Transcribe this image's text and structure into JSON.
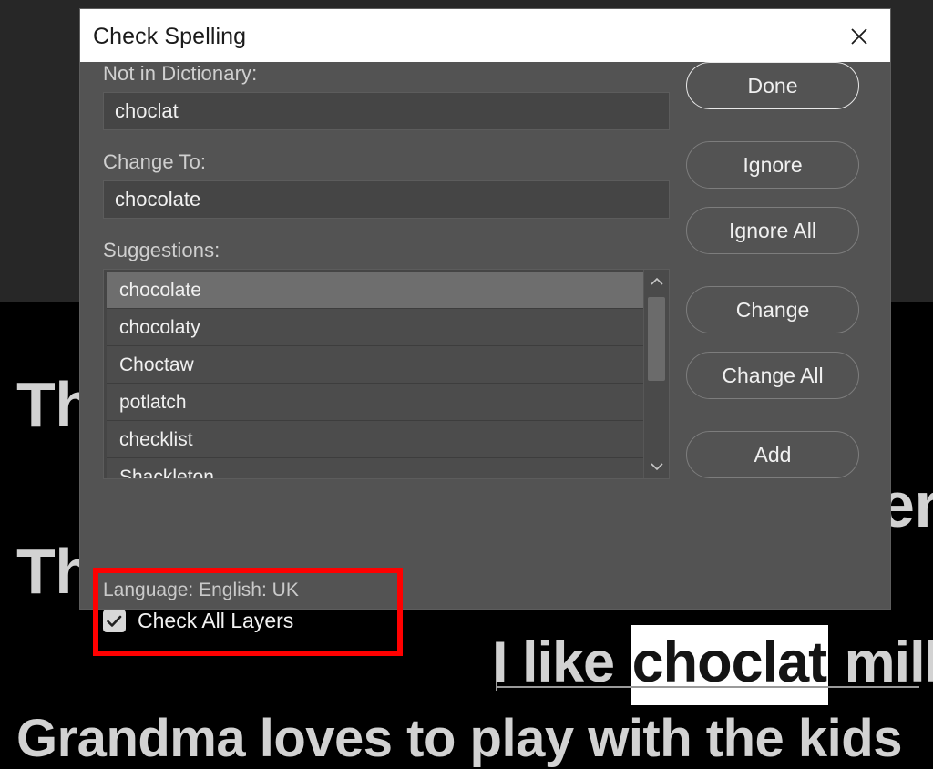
{
  "background_document": {
    "lines": [
      {
        "id": "line1",
        "text": "Th"
      },
      {
        "id": "line2",
        "text": "Th"
      },
      {
        "id": "line4",
        "text": "Grandma loves to play with the kids"
      }
    ],
    "occluded_right_fragment": "er",
    "highlighted_sentence": {
      "prefix": "I like ",
      "misspelled_word": "choclat",
      "suffix": " milk"
    }
  },
  "dialog": {
    "title": "Check Spelling",
    "close_icon": "close-icon",
    "fields": {
      "not_in_dictionary": {
        "label": "Not in Dictionary:",
        "value": "choclat",
        "placeholder": ""
      },
      "change_to": {
        "label": "Change To:",
        "value": "chocolate",
        "placeholder": ""
      },
      "suggestions": {
        "label": "Suggestions:",
        "selected_index": 0,
        "items": [
          "chocolate",
          "chocolaty",
          "Choctaw",
          "potlatch",
          "checklist",
          "Shackleton"
        ]
      }
    },
    "scrollbar": {
      "up_icon": "chevron-up-icon",
      "down_icon": "chevron-down-icon"
    },
    "options": {
      "language_status": "Language: English: UK",
      "check_all_layers": {
        "label": "Check All Layers",
        "checked": true,
        "check_icon": "check-icon"
      },
      "annotation_color": "#ff0000"
    },
    "buttons": [
      {
        "label": "Done",
        "primary": true
      },
      {
        "label": "Ignore",
        "primary": false
      },
      {
        "label": "Ignore All",
        "primary": false
      },
      {
        "label": "Change",
        "primary": false
      },
      {
        "label": "Change All",
        "primary": false
      },
      {
        "label": "Add",
        "primary": false
      }
    ]
  },
  "colors": {
    "dialog_background": "#535353",
    "titlebar_background": "#ffffff",
    "input_background": "#454545",
    "list_item_background": "#4c4c4c",
    "list_item_selected": "#6e6e6e",
    "annotation_red": "#ff0000",
    "canvas_upper": "#272727",
    "canvas_lower": "#000000"
  }
}
